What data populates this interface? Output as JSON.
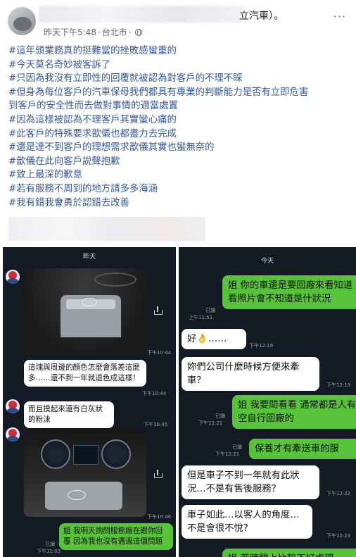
{
  "post": {
    "author_suffix": "立汽車）。",
    "time": "昨天下午5:48",
    "separator": "·",
    "location": "台北市",
    "separator2": "·",
    "more": "···",
    "lines": [
      "#這年頭業務真的挺難當的挫敗感蠻重的",
      "#今天莫名奇妙被客訴了",
      "#只因為我沒有立即性的回覆就被認為對客戶的不理不睬",
      "#但身為每位客戶的汽車保母我們都具有專業的判斷能力是否有立即危害",
      "到客戶的安全性而去做對事情的適當處置",
      "#因為這樣被認為不理客戶其實蠻心痛的",
      "#此客戶的特殊要求歆儀也都盡力去完成",
      "#還是達不到客戶的理想需求歆儀其實也蠻無奈的",
      "#歆儀在此向客戶說聲抱歉",
      "#致上最深的歉意",
      "#若有服務不周到的地方請多多海涵",
      "#我有錯我會勇於認錯去改善"
    ]
  },
  "left_chat": {
    "day": "昨天",
    "ts_photo1": "下午10:44",
    "msg1": "這塊與周邊的顏色怎麼會落差這麼多……還不到一年就退色成這樣！",
    "ts_msg1": "下午10:44",
    "msg2": "而且摸起來還有白灰狀的粉沫",
    "ts_msg2": "下午10:45",
    "ts_photo2": "下午10:46",
    "read": "已讀",
    "ts_msg3": "下午11:03",
    "msg3": "姐 我明天詢問服務廠在跟你回覆 因為我也沒有遇過這個問題"
  },
  "right_chat": {
    "day": "今天",
    "msg1": "姐 你的車還是要回廠來看知道 看照片會不知道是什狀況",
    "read1": "已讀",
    "ts_msg1": "上午11:51",
    "msg2": "好👌……",
    "ts_msg2": "下午12:19",
    "msg3": "妳們公司什麼時候方便來牽車？",
    "ts_msg3": "下午12:19",
    "msg4": "姐 我要問看看 通常都是人有空自行回廠的",
    "read4": "已讀",
    "ts_msg4": "下午12:21",
    "msg5": "保養才有牽送車的服",
    "read5": "已讀",
    "ts_msg5": "下午12:21",
    "msg6": "但是車子不到一年就有此狀況…不是有售後服務？",
    "ts_msg6": "下午12:22",
    "msg7": "車子如此…以客人的角度…不是會很不悅?",
    "ts_msg7": "下午12:23",
    "msg8": "姐 若時間上比較不好處理"
  }
}
